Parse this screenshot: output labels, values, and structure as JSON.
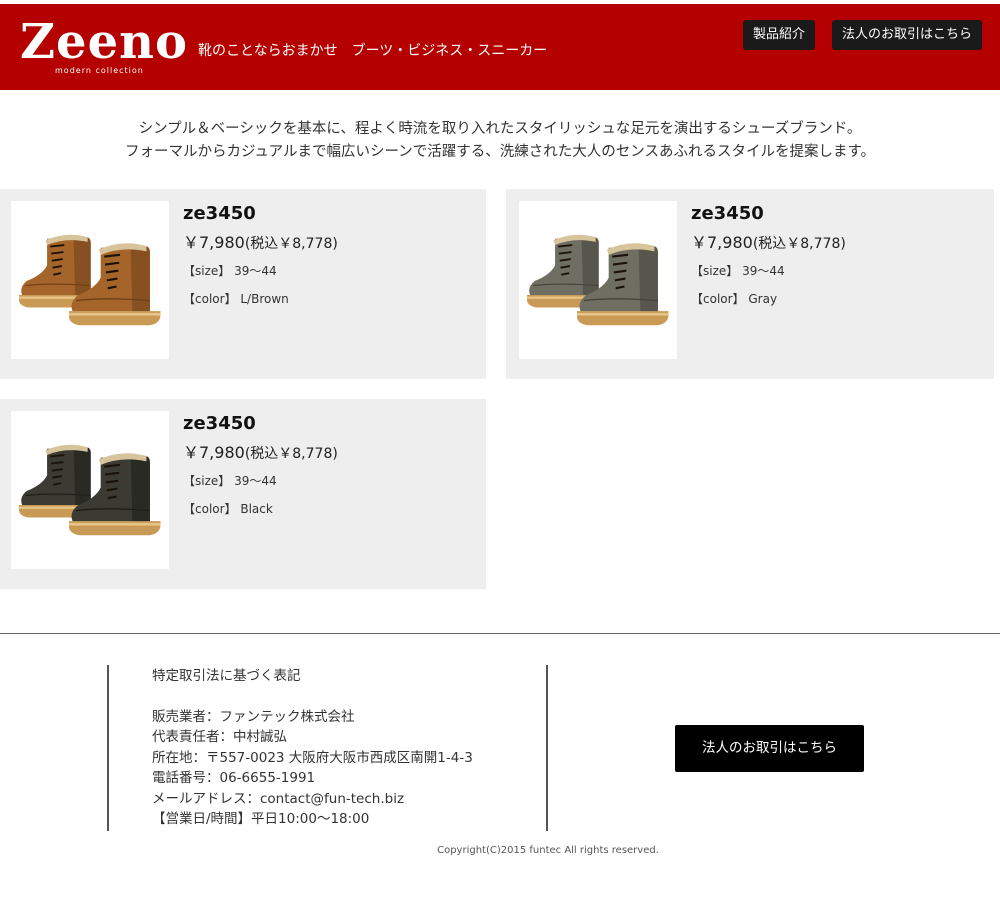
{
  "header": {
    "logo": "Zeeno",
    "logo_sub": "modern collection",
    "tagline": "靴のことならおまかせ　ブーツ・ビジネス・スニーカー",
    "nav": {
      "products": "製品紹介",
      "corporate": "法人のお取引はこちら"
    }
  },
  "intro": {
    "line1": "シンプル＆ベーシックを基本に、程よく時流を取り入れたスタイリッシュな足元を演出するシューズブランド。",
    "line2": "フォーマルからカジュアルまで幅広いシーンで活躍する、洗練された大人のセンスあふれるスタイルを提案します。"
  },
  "products": [
    {
      "code": "ze3450",
      "price": "￥7,980",
      "tax": "(税込￥8,778)",
      "size": "【size】 39～44",
      "color": "【color】 L/Brown",
      "boot_color": "#a5652a",
      "boot_dark": "#6f3f17"
    },
    {
      "code": "ze3450",
      "price": "￥7,980",
      "tax": "(税込￥8,778)",
      "size": "【size】 39～44",
      "color": "【color】 Gray",
      "boot_color": "#6f6e62",
      "boot_dark": "#44443b"
    },
    {
      "code": "ze3450",
      "price": "￥7,980",
      "tax": "(税込￥8,778)",
      "size": "【size】 39～44",
      "color": "【color】 Black",
      "boot_color": "#3b3b34",
      "boot_dark": "#1d1d1a"
    }
  ],
  "footer": {
    "title": "特定取引法に基づく表記",
    "seller": "販売業者：ファンテック株式会社",
    "manager": "代表責任者：中村誠弘",
    "address": "所在地：〒557-0023 大阪府大阪市西成区南開1-4-3",
    "phone": "電話番号：06-6655-1991",
    "email": "メールアドレス：contact@fun-tech.biz",
    "hours": "【営業日/時間】平日10:00～18:00",
    "corp_button": "法人のお取引はこちら",
    "copyright": "Copyright(C)2015 funtec All rights reserved."
  }
}
